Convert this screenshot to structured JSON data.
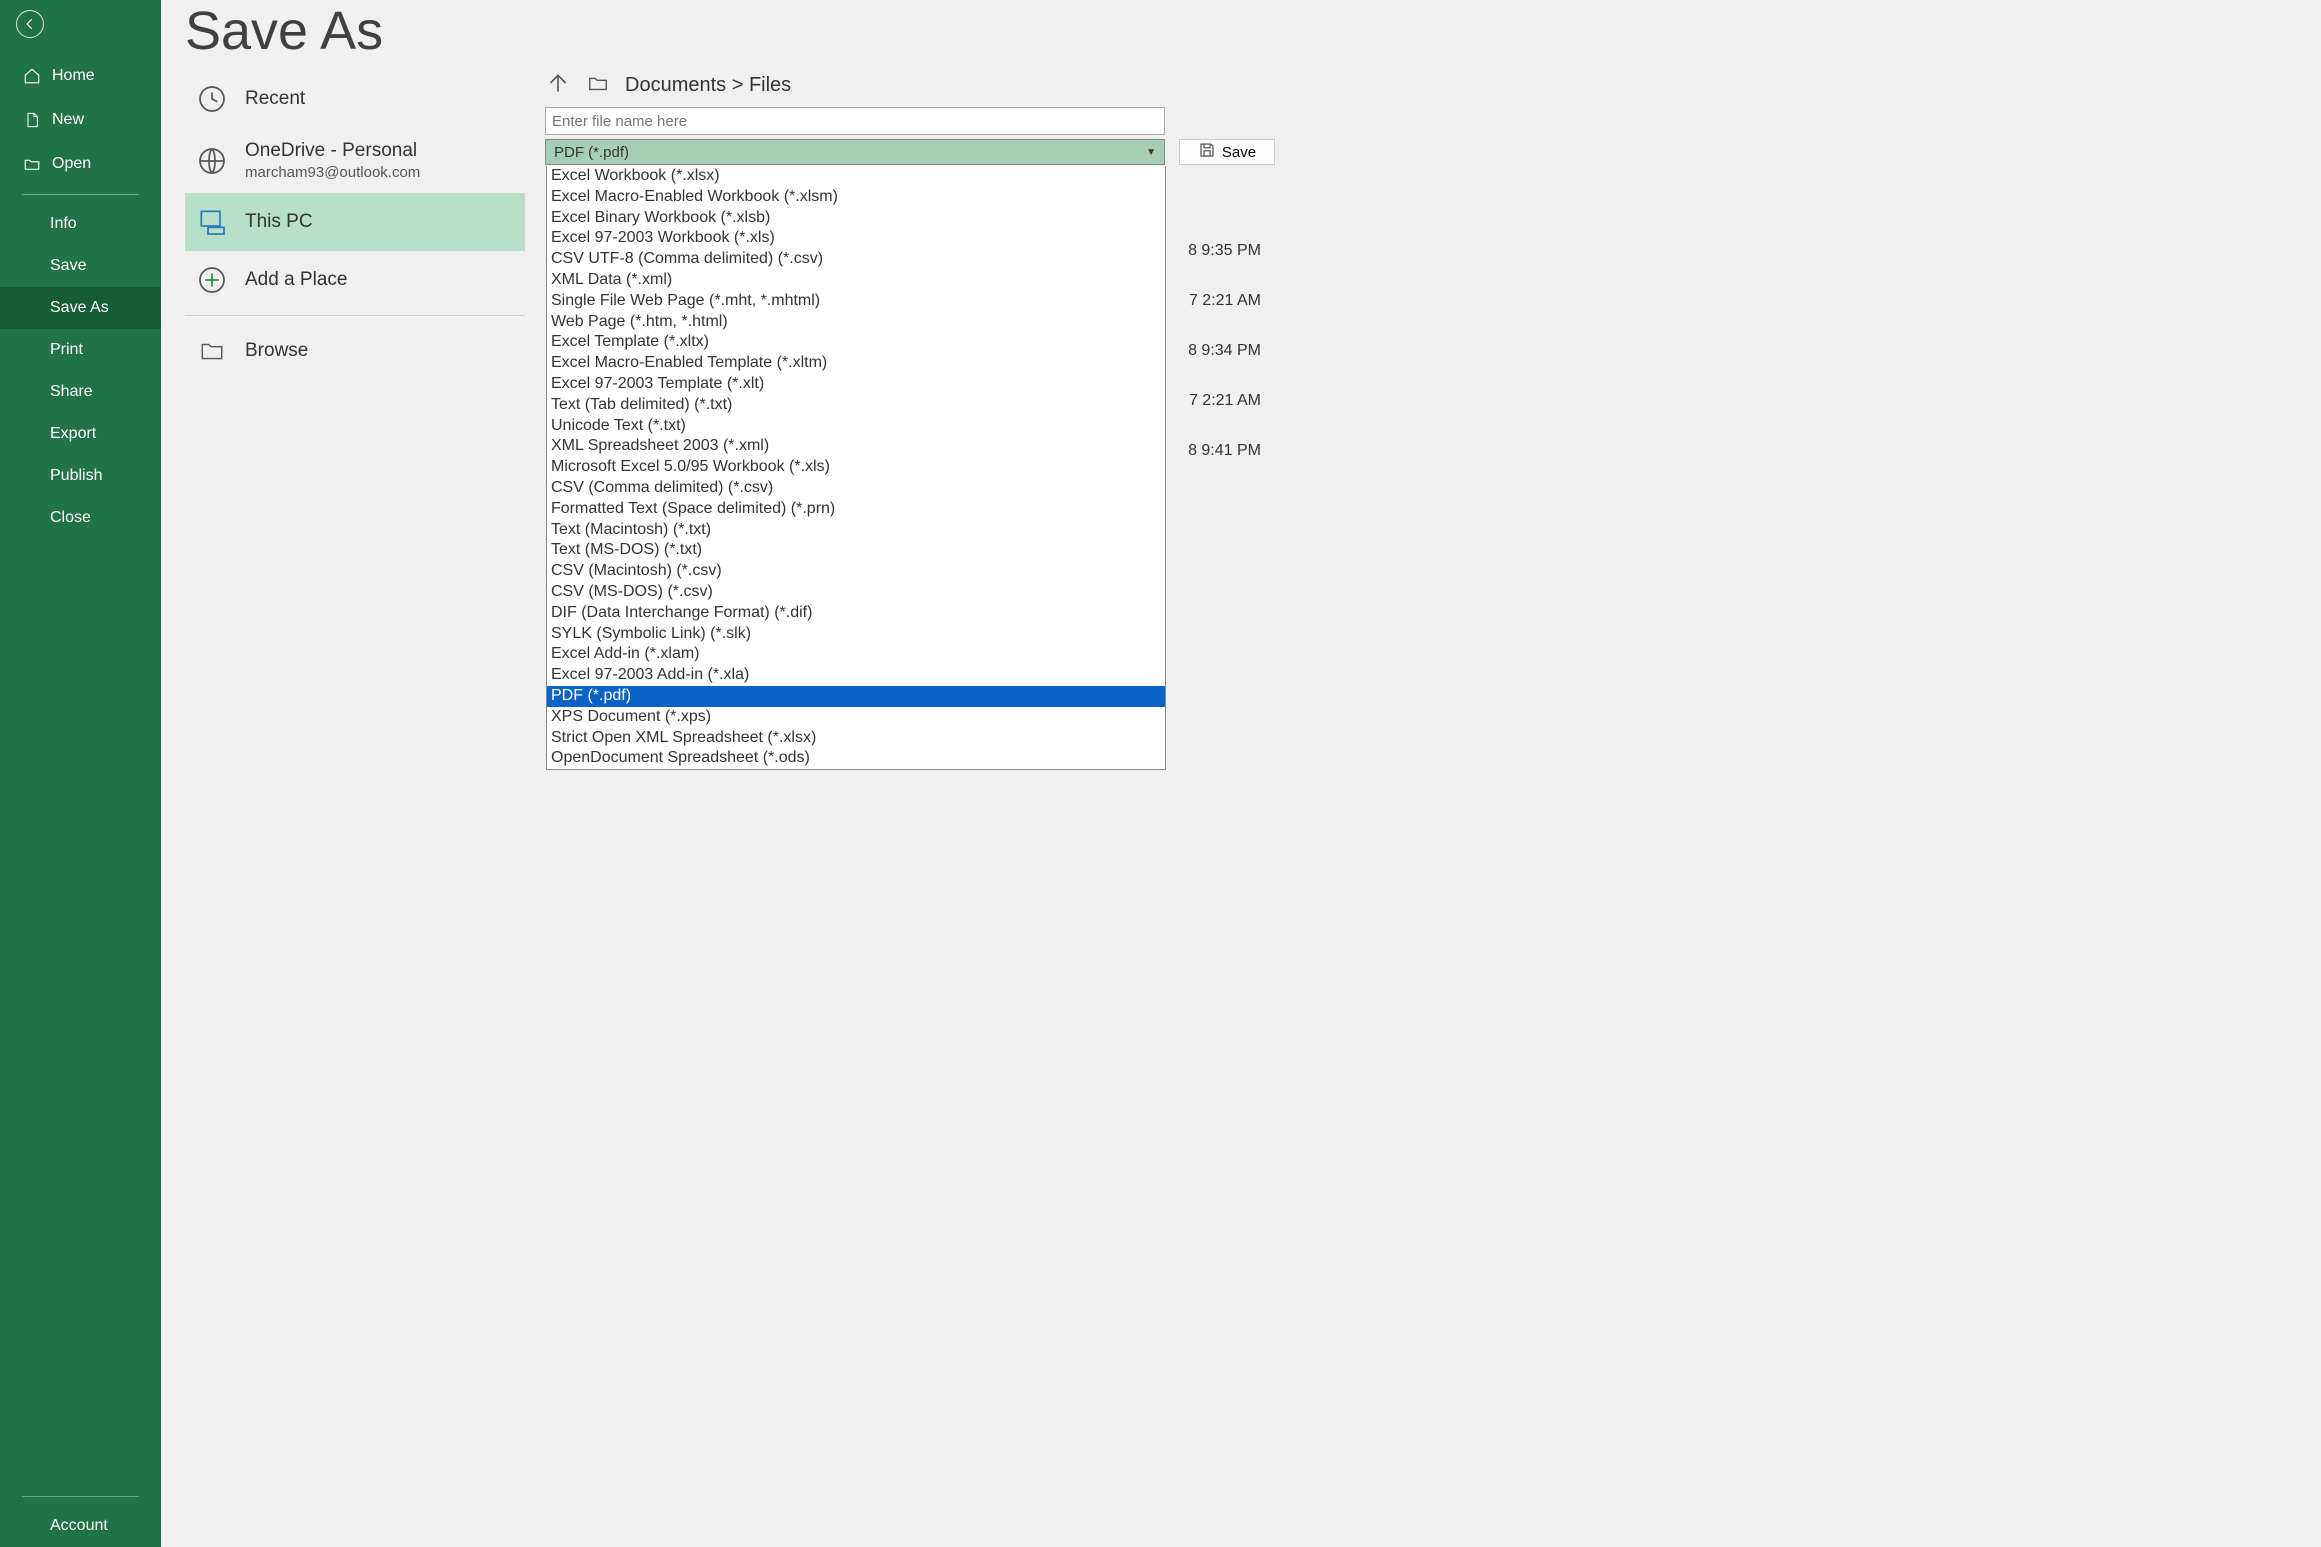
{
  "page": {
    "title": "Save As"
  },
  "sidebar": {
    "home": "Home",
    "new": "New",
    "open": "Open",
    "info": "Info",
    "save": "Save",
    "saveas": "Save As",
    "print": "Print",
    "share": "Share",
    "export": "Export",
    "publish": "Publish",
    "close": "Close",
    "account": "Account"
  },
  "locations": {
    "recent": "Recent",
    "onedrive": "OneDrive - Personal",
    "onedrive_sub": "marcham93@outlook.com",
    "thispc": "This PC",
    "addplace": "Add a Place",
    "browse": "Browse"
  },
  "savepanel": {
    "breadcrumb": "Documents > Files",
    "filename_placeholder": "Enter file name here",
    "selected_format": "PDF (*.pdf)",
    "save_label": "Save"
  },
  "formats": [
    "Excel Workbook (*.xlsx)",
    "Excel Macro-Enabled Workbook (*.xlsm)",
    "Excel Binary Workbook (*.xlsb)",
    "Excel 97-2003 Workbook (*.xls)",
    "CSV UTF-8 (Comma delimited) (*.csv)",
    "XML Data (*.xml)",
    "Single File Web Page (*.mht, *.mhtml)",
    "Web Page (*.htm, *.html)",
    "Excel Template (*.xltx)",
    "Excel Macro-Enabled Template (*.xltm)",
    "Excel 97-2003 Template (*.xlt)",
    "Text (Tab delimited) (*.txt)",
    "Unicode Text (*.txt)",
    "XML Spreadsheet 2003 (*.xml)",
    "Microsoft Excel 5.0/95 Workbook (*.xls)",
    "CSV (Comma delimited) (*.csv)",
    "Formatted Text (Space delimited) (*.prn)",
    "Text (Macintosh) (*.txt)",
    "Text (MS-DOS) (*.txt)",
    "CSV (Macintosh) (*.csv)",
    "CSV (MS-DOS) (*.csv)",
    "DIF (Data Interchange Format) (*.dif)",
    "SYLK (Symbolic Link) (*.slk)",
    "Excel Add-in (*.xlam)",
    "Excel 97-2003 Add-in (*.xla)",
    "PDF (*.pdf)",
    "XPS Document (*.xps)",
    "Strict Open XML Spreadsheet (*.xlsx)",
    "OpenDocument Spreadsheet (*.ods)"
  ],
  "files": [
    {
      "modified": "8 9:35 PM"
    },
    {
      "modified": "7 2:21 AM"
    },
    {
      "modified": "8 9:34 PM"
    },
    {
      "modified": "7 2:21 AM"
    },
    {
      "modified": "8 9:41 PM"
    }
  ]
}
